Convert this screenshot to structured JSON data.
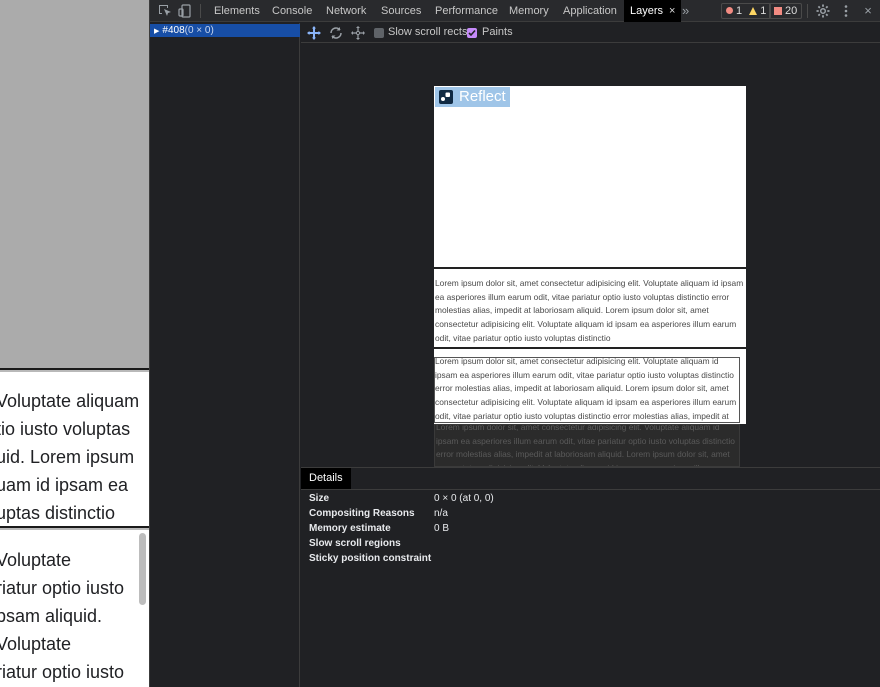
{
  "page": {
    "middle_lines": [
      "Voluptate aliquam",
      "tio iusto voluptas",
      "uid. Lorem ipsum",
      "uam id ipsam ea",
      "uptas distinctio"
    ],
    "bottom_lines": [
      "Voluptate",
      "riatur optio iusto",
      "psam aliquid.",
      "Voluptate",
      "riatur optio iusto"
    ]
  },
  "devtools": {
    "tabs": [
      {
        "label": "Elements"
      },
      {
        "label": "Console"
      },
      {
        "label": "Network"
      },
      {
        "label": "Sources"
      },
      {
        "label": "Performance"
      },
      {
        "label": "Memory"
      },
      {
        "label": "Application"
      },
      {
        "label": "Layers",
        "active": true
      }
    ],
    "more_tabs": "»",
    "close_tab": "×",
    "badges": {
      "errors": "1",
      "warnings": "1",
      "issues": "20"
    },
    "close_devtools": "×"
  },
  "layer_tree": {
    "selected_layer": "#408",
    "selected_layer_size": "(0 × 0)"
  },
  "viewer_toolbar": {
    "slow_scroll_label": "Slow scroll rects",
    "slow_scroll_checked": false,
    "paints_label": "Paints",
    "paints_checked": true
  },
  "viewport": {
    "logo_text": "Reflect",
    "paragraph_1": "Lorem ipsum dolor sit, amet consectetur adipisicing elit. Voluptate aliquam id ipsam ea asperiores illum earum odit, vitae pariatur optio iusto voluptas distinctio error molestias alias, impedit at laboriosam aliquid. Lorem ipsum dolor sit, amet consectetur adipisicing elit. Voluptate aliquam id ipsam ea asperiores illum earum odit, vitae pariatur optio iusto voluptas distinctio",
    "paragraph_2": "Lorem ipsum dolor sit, amet consectetur adipisicing elit. Voluptate aliquam id ipsam ea asperiores illum earum odit, vitae pariatur optio iusto voluptas distinctio error molestias alias, impedit at laboriosam aliquid. Lorem ipsum dolor sit, amet consectetur adipisicing elit. Voluptate aliquam id ipsam ea asperiores illum earum odit, vitae pariatur optio iusto voluptas distinctio error molestias alias, impedit at laboriosam aliquid. Lorem ipsum dolor sit, amet consectetur adipisicing elit. Voluptate aliquam id ipsam ea asperiores illum earum odit, vitae pariatur optio iusto"
  },
  "details": {
    "tab_label": "Details",
    "rows": [
      {
        "key": "Size",
        "value": "0 × 0 (at 0, 0)"
      },
      {
        "key": "Compositing Reasons",
        "value": "n/a"
      },
      {
        "key": "Memory estimate",
        "value": "0 B"
      },
      {
        "key": "Slow scroll regions",
        "value": ""
      },
      {
        "key": "Sticky position constraint",
        "value": ""
      }
    ]
  },
  "colors": {
    "selection": "#174ea6",
    "panel_bg": "#202124",
    "logo_highlight": "#9fc5e8"
  }
}
